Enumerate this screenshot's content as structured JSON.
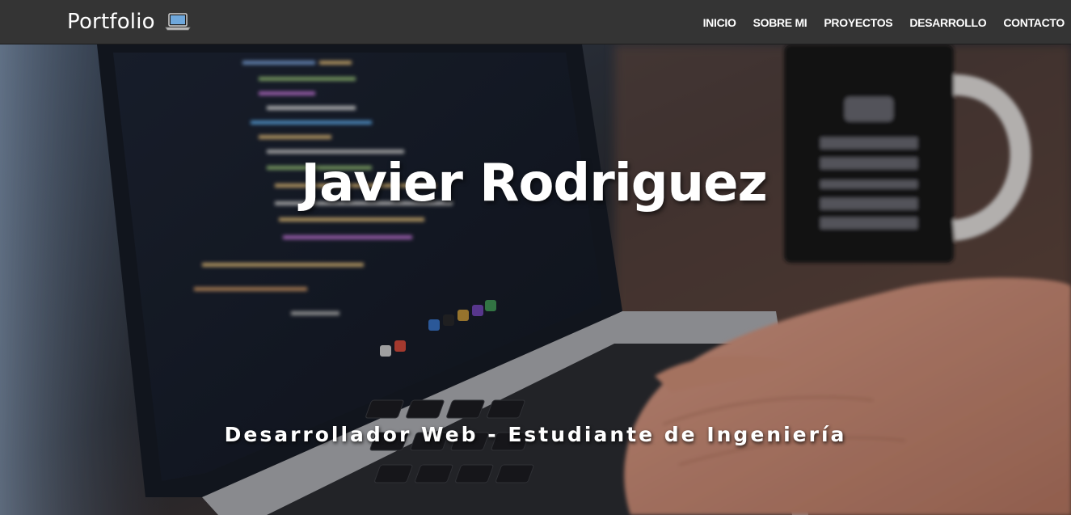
{
  "navbar": {
    "brand": "Portfolio",
    "brand_icon": "laptop-icon",
    "links": [
      "INICIO",
      "SOBRE MI",
      "PROYECTOS",
      "DESARROLLO",
      "CONTACTO"
    ]
  },
  "hero": {
    "title": "Javier Rodriguez",
    "subtitle": "Desarrollador Web - Estudiante de Ingeniería",
    "background": "laptop-with-code-and-coffee-mug-photo"
  },
  "colors": {
    "navbar_bg": "#343434",
    "text": "#ffffff"
  }
}
